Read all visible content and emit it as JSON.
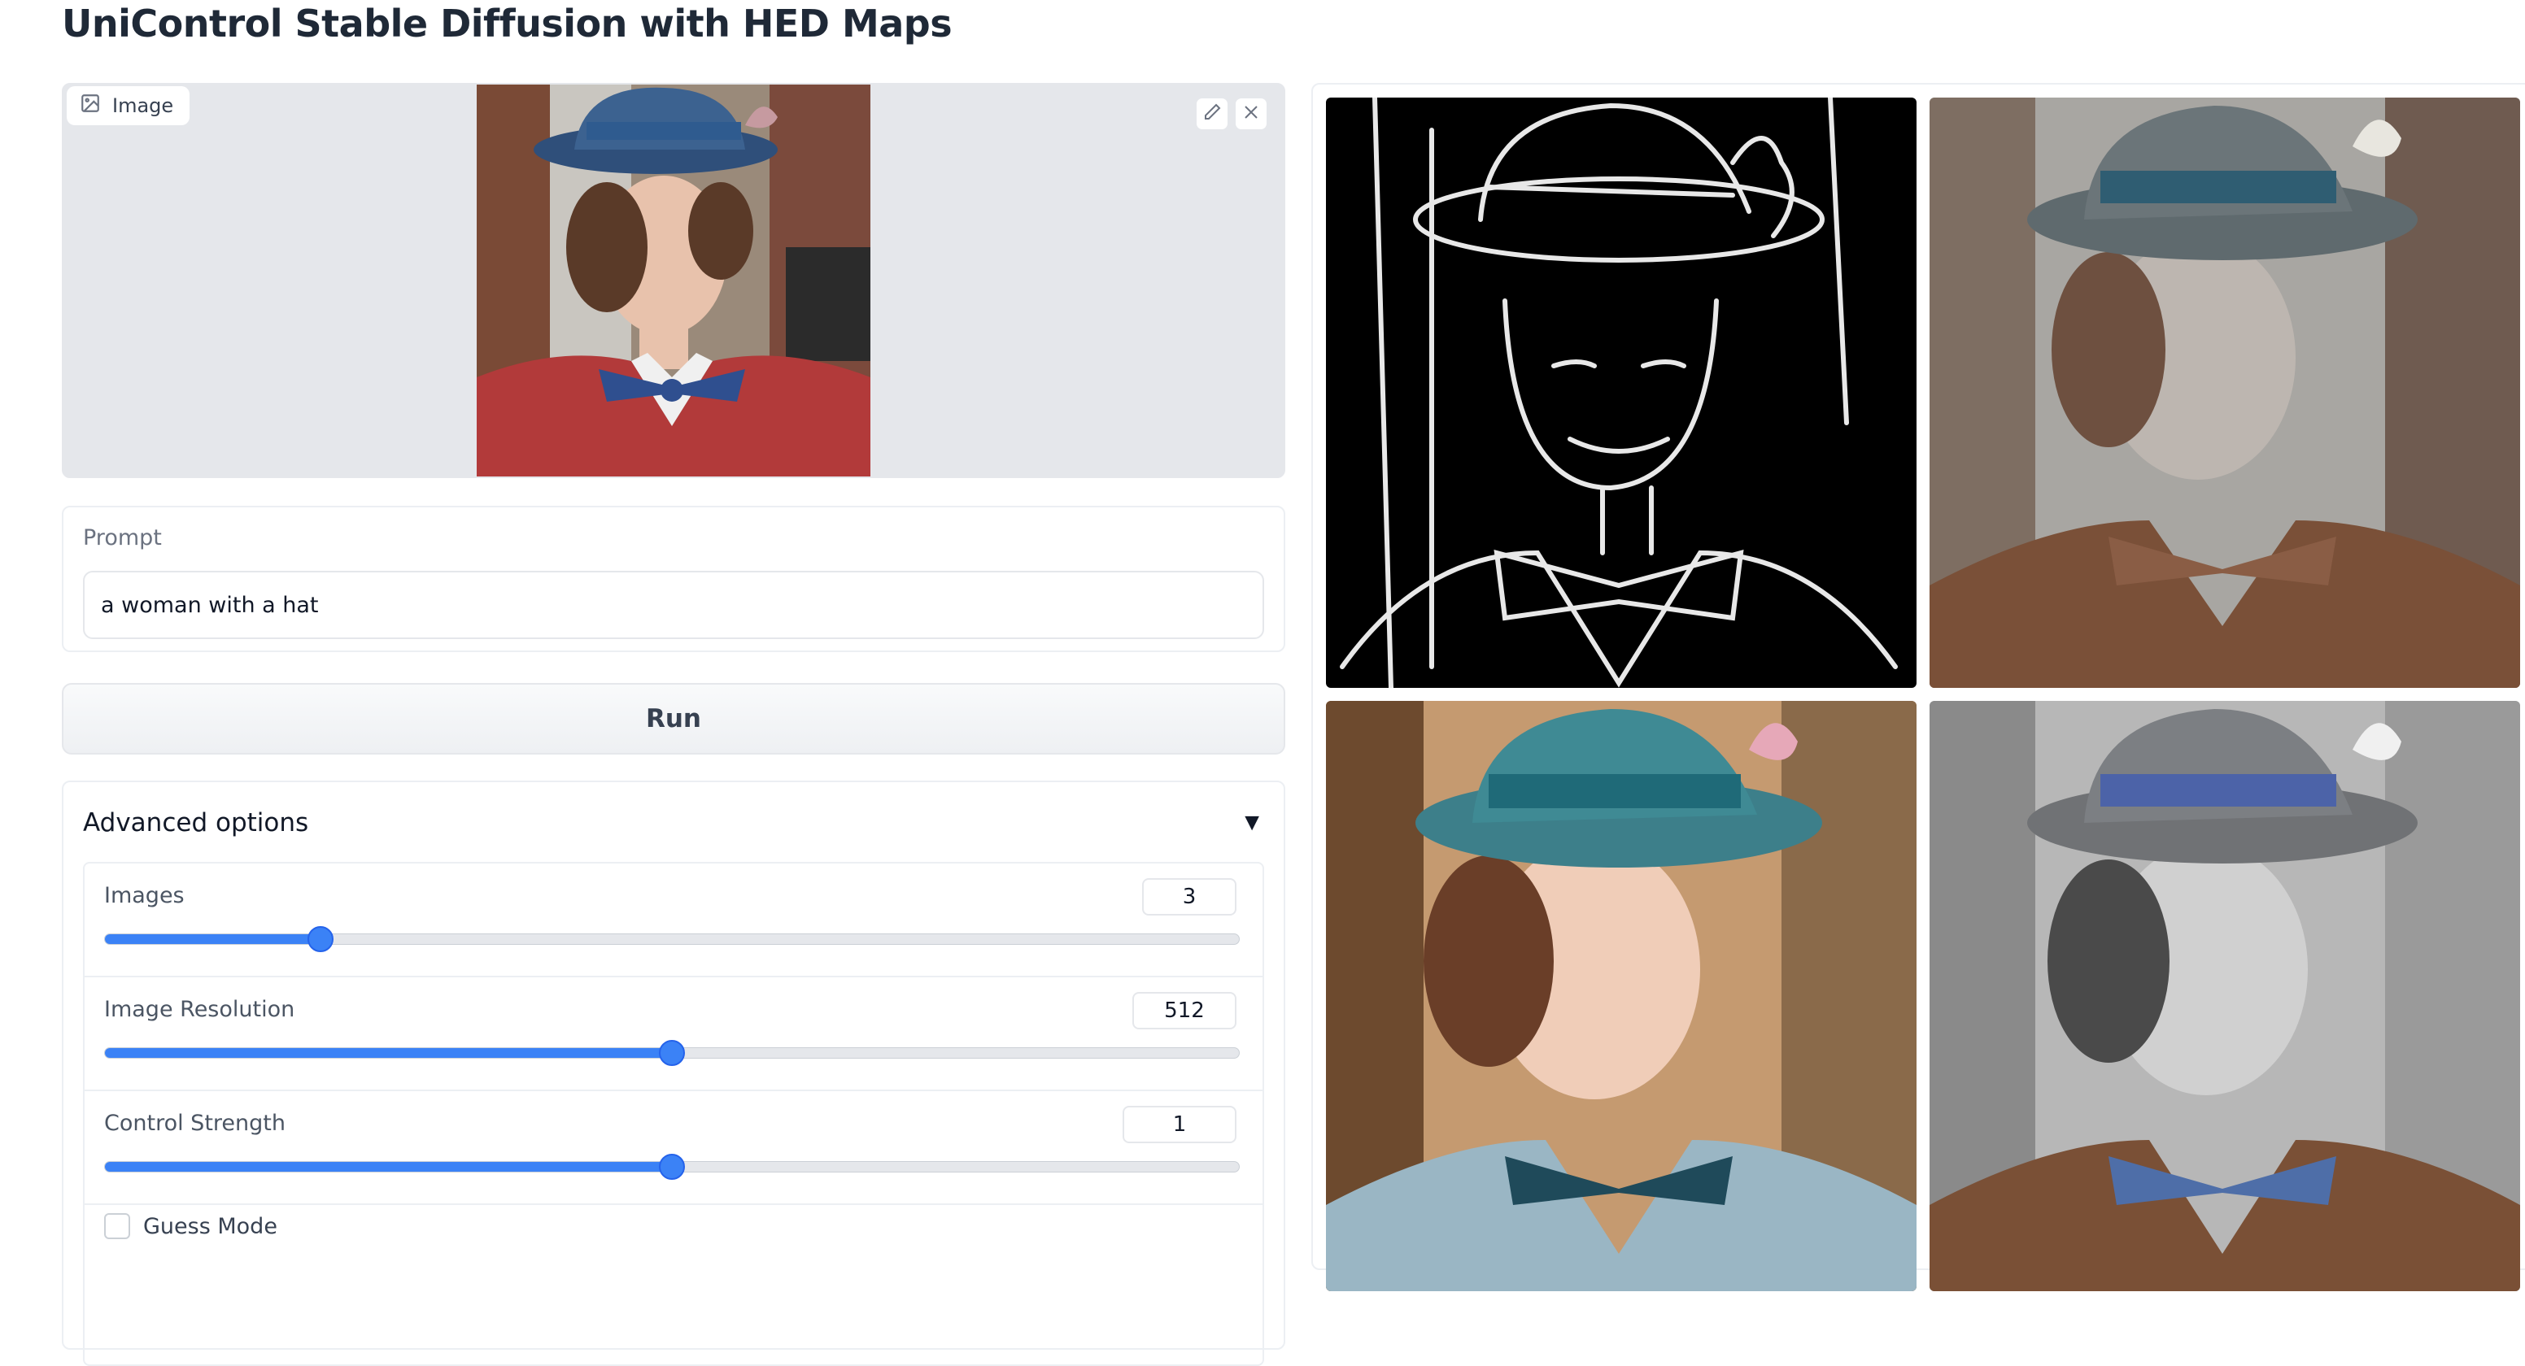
{
  "page": {
    "title": "UniControl Stable Diffusion with HED Maps"
  },
  "image_input": {
    "label": "Image",
    "icons": [
      "image-icon",
      "pencil-icon",
      "close-icon"
    ]
  },
  "prompt": {
    "label": "Prompt",
    "value": "a woman with a hat"
  },
  "run_button": {
    "label": "Run"
  },
  "advanced": {
    "title": "Advanced options",
    "expanded_indicator": "▼",
    "sliders": [
      {
        "label": "Images",
        "value": "3",
        "fraction": 0.19
      },
      {
        "label": "Image Resolution",
        "value": "512",
        "fraction": 0.5
      },
      {
        "label": "Control Strength",
        "value": "1",
        "fraction": 0.5
      }
    ],
    "guess_mode": {
      "label": "Guess Mode",
      "checked": false
    }
  },
  "gallery": {
    "items": [
      "hed-edge-map",
      "generated-image-1",
      "generated-image-2",
      "generated-image-3"
    ]
  },
  "colors": {
    "accent": "#3b82f6",
    "panel_bg": "#e5e7eb",
    "border": "#eceff3"
  }
}
